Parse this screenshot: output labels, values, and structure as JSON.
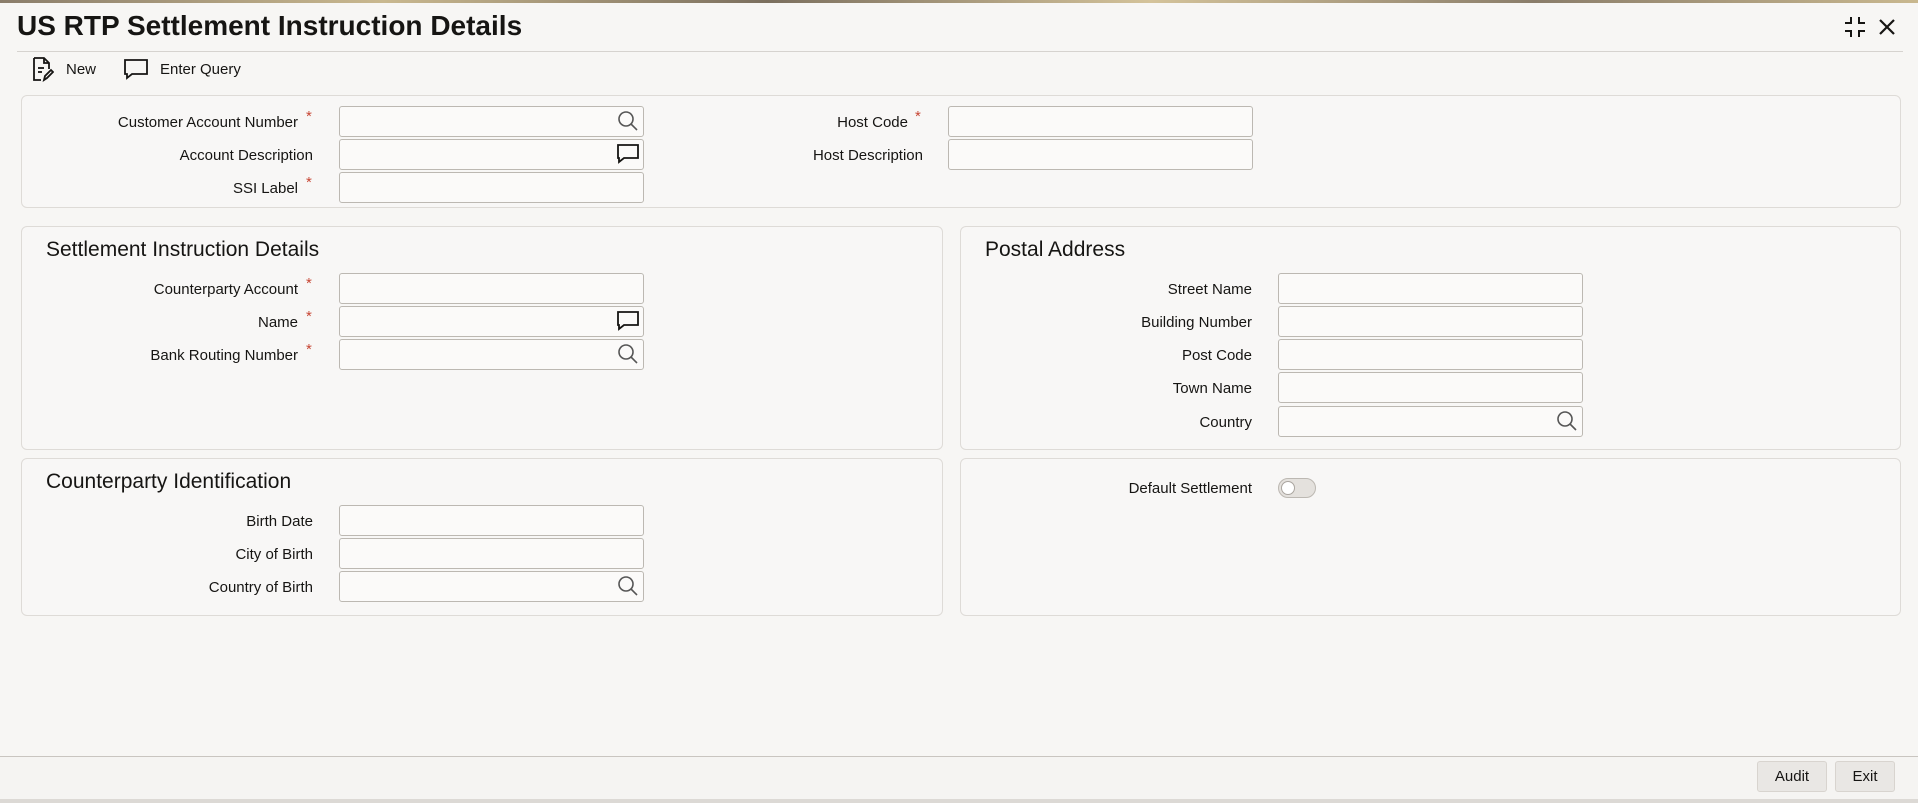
{
  "window": {
    "title": "US RTP Settlement Instruction Details",
    "controls": [
      "maximize-icon",
      "close-icon"
    ]
  },
  "toolbar": {
    "new_label": "New",
    "enter_query_label": "Enter Query"
  },
  "header_form": {
    "customer_account_number": {
      "label": "Customer Account Number",
      "required": "*",
      "value": ""
    },
    "account_description": {
      "label": "Account Description",
      "value": ""
    },
    "ssi_label": {
      "label": "SSI Label",
      "required": "*",
      "value": ""
    },
    "host_code": {
      "label": "Host Code",
      "required": "*",
      "value": ""
    },
    "host_description": {
      "label": "Host Description",
      "value": ""
    }
  },
  "settlement": {
    "title": "Settlement Instruction Details",
    "counterparty_account": {
      "label": "Counterparty Account",
      "required": "*",
      "value": ""
    },
    "name": {
      "label": "Name",
      "required": "*",
      "value": ""
    },
    "bank_routing_number": {
      "label": "Bank Routing Number",
      "required": "*",
      "value": ""
    }
  },
  "postal": {
    "title": "Postal Address",
    "street_name": {
      "label": "Street Name",
      "value": ""
    },
    "building_number": {
      "label": "Building Number",
      "value": ""
    },
    "post_code": {
      "label": "Post Code",
      "value": ""
    },
    "town_name": {
      "label": "Town Name",
      "value": ""
    },
    "country": {
      "label": "Country",
      "value": ""
    }
  },
  "counterparty_id": {
    "title": "Counterparty Identification",
    "birth_date": {
      "label": "Birth Date",
      "value": ""
    },
    "city_of_birth": {
      "label": "City of Birth",
      "value": ""
    },
    "country_of_birth": {
      "label": "Country of Birth",
      "value": ""
    }
  },
  "default_settlement": {
    "label": "Default Settlement",
    "enabled": false
  },
  "footer": {
    "audit_label": "Audit",
    "exit_label": "Exit"
  },
  "colors": {
    "required": "#c74634",
    "panel_border": "#dedbd7",
    "field_border": "#bcb8b2"
  }
}
